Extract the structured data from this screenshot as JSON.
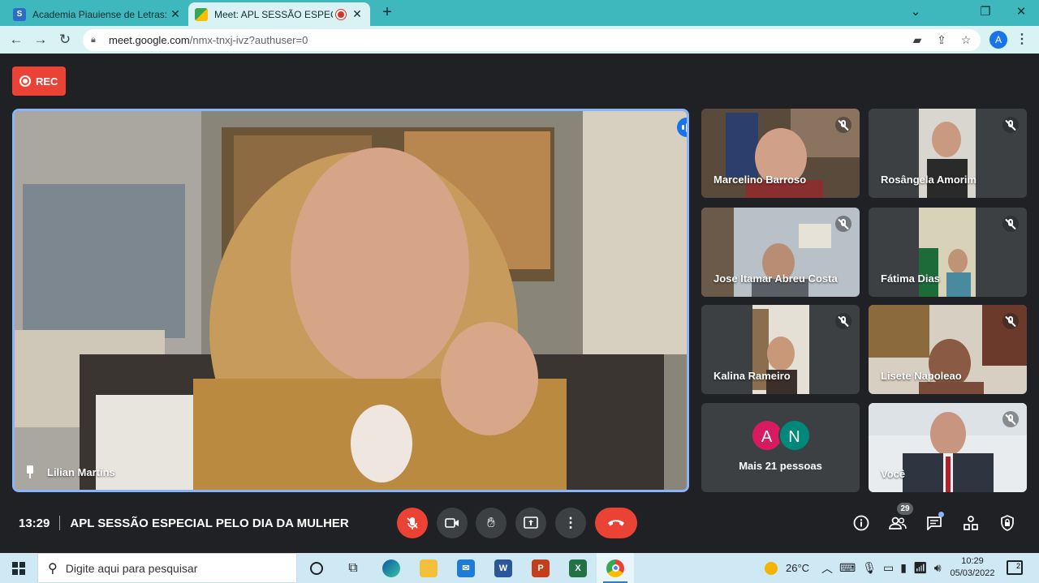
{
  "browser": {
    "tabs": [
      {
        "title": "Academia Piauiense de Letras: ag",
        "favicon": "S"
      },
      {
        "title": "Meet: APL SESSÃO ESPECIAL",
        "favicon": "M"
      }
    ],
    "new_tab": "+",
    "window_controls": {
      "minimize": "⌄",
      "restore": "❐",
      "close": "✕"
    },
    "url_host": "meet.google.com",
    "url_path": "/nmx-tnxj-ivz?authuser=0",
    "profile_initial": "A"
  },
  "meet": {
    "rec_label": "REC",
    "main_speaker": "Lilian Martins",
    "participants": [
      {
        "name": "Marcelino Barroso"
      },
      {
        "name": "Rosângela Amorim"
      },
      {
        "name": "Jose Itamar Abreu Costa"
      },
      {
        "name": "Fátima Dias"
      },
      {
        "name": "Kalina Rameiro"
      },
      {
        "name": "Lisete Napoleao"
      },
      {
        "name": "Você"
      }
    ],
    "more": {
      "avatars": [
        {
          "initial": "A",
          "color": "#d81b60"
        },
        {
          "initial": "N",
          "color": "#00897b"
        }
      ],
      "label": "Mais 21 pessoas"
    },
    "clock": "13:29",
    "meeting_title": "APL SESSÃO ESPECIAL PELO DIA DA MULHER",
    "people_count": "29"
  },
  "taskbar": {
    "search_placeholder": "Digite aqui para pesquisar",
    "weather": "26°C",
    "time": "10:29",
    "date": "05/03/2022",
    "notifications": "2"
  },
  "colors": {
    "accent": "#8ab4f8",
    "danger": "#ea4335",
    "meet_bg": "#202124",
    "tab_strip": "#3fb8bd"
  }
}
